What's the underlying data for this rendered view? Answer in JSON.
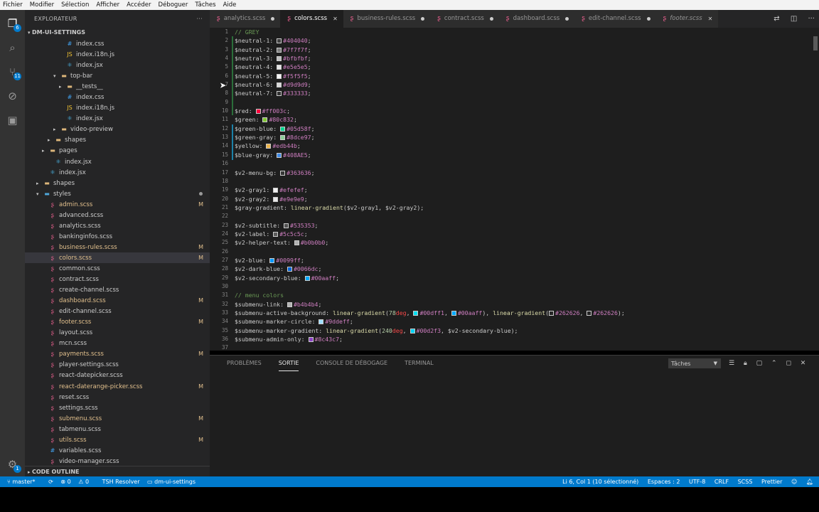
{
  "menu": [
    "Fichier",
    "Modifier",
    "Sélection",
    "Afficher",
    "Accéder",
    "Déboguer",
    "Tâches",
    "Aide"
  ],
  "activity": {
    "explorer_badge": "6",
    "scm_badge": "11",
    "settings_badge": "1"
  },
  "sidebar": {
    "title": "EXPLORATEUR",
    "dots": "···",
    "section": "DM-UI-SETTINGS",
    "outline": "CODE OUTLINE",
    "items": [
      {
        "label": "index.css",
        "indent": 5,
        "icon": "css",
        "arrow": ""
      },
      {
        "label": "index.i18n.js",
        "indent": 5,
        "icon": "js",
        "arrow": ""
      },
      {
        "label": "index.jsx",
        "indent": 5,
        "icon": "jsx",
        "arrow": ""
      },
      {
        "label": "top-bar",
        "indent": 4,
        "icon": "folder-open",
        "arrow": "▾"
      },
      {
        "label": "__tests__",
        "indent": 5,
        "icon": "folder-test",
        "arrow": "▸"
      },
      {
        "label": "index.css",
        "indent": 5,
        "icon": "css",
        "arrow": ""
      },
      {
        "label": "index.i18n.js",
        "indent": 5,
        "icon": "js",
        "arrow": ""
      },
      {
        "label": "index.jsx",
        "indent": 5,
        "icon": "jsx",
        "arrow": ""
      },
      {
        "label": "video-preview",
        "indent": 4,
        "icon": "folder",
        "arrow": "▸"
      },
      {
        "label": "shapes",
        "indent": 3,
        "icon": "folder",
        "arrow": "▸"
      },
      {
        "label": "pages",
        "indent": 2,
        "icon": "folder-pages",
        "arrow": "▸"
      },
      {
        "label": "index.jsx",
        "indent": 3,
        "icon": "jsx",
        "arrow": ""
      },
      {
        "label": "index.jsx",
        "indent": 2,
        "icon": "jsx",
        "arrow": ""
      },
      {
        "label": "shapes",
        "indent": 1,
        "icon": "folder",
        "arrow": "▸"
      },
      {
        "label": "styles",
        "indent": 1,
        "icon": "folder-styles",
        "arrow": "▾",
        "dot": true
      },
      {
        "label": "admin.scss",
        "indent": 2,
        "icon": "scss",
        "arrow": "",
        "mark": "M"
      },
      {
        "label": "advanced.scss",
        "indent": 2,
        "icon": "scss",
        "arrow": ""
      },
      {
        "label": "analytics.scss",
        "indent": 2,
        "icon": "scss",
        "arrow": ""
      },
      {
        "label": "bankinginfos.scss",
        "indent": 2,
        "icon": "scss",
        "arrow": ""
      },
      {
        "label": "business-rules.scss",
        "indent": 2,
        "icon": "scss",
        "arrow": "",
        "mark": "M"
      },
      {
        "label": "colors.scss",
        "indent": 2,
        "icon": "scss",
        "arrow": "",
        "mark": "M",
        "selected": true
      },
      {
        "label": "common.scss",
        "indent": 2,
        "icon": "scss",
        "arrow": ""
      },
      {
        "label": "contract.scss",
        "indent": 2,
        "icon": "scss",
        "arrow": ""
      },
      {
        "label": "create-channel.scss",
        "indent": 2,
        "icon": "scss",
        "arrow": ""
      },
      {
        "label": "dashboard.scss",
        "indent": 2,
        "icon": "scss",
        "arrow": "",
        "mark": "M"
      },
      {
        "label": "edit-channel.scss",
        "indent": 2,
        "icon": "scss",
        "arrow": ""
      },
      {
        "label": "footer.scss",
        "indent": 2,
        "icon": "scss",
        "arrow": "",
        "mark": "M"
      },
      {
        "label": "layout.scss",
        "indent": 2,
        "icon": "scss",
        "arrow": ""
      },
      {
        "label": "mcn.scss",
        "indent": 2,
        "icon": "scss",
        "arrow": ""
      },
      {
        "label": "payments.scss",
        "indent": 2,
        "icon": "scss",
        "arrow": "",
        "mark": "M"
      },
      {
        "label": "player-settings.scss",
        "indent": 2,
        "icon": "scss",
        "arrow": ""
      },
      {
        "label": "react-datepicker.scss",
        "indent": 2,
        "icon": "scss",
        "arrow": ""
      },
      {
        "label": "react-daterange-picker.scss",
        "indent": 2,
        "icon": "scss",
        "arrow": "",
        "mark": "M"
      },
      {
        "label": "reset.scss",
        "indent": 2,
        "icon": "scss",
        "arrow": ""
      },
      {
        "label": "settings.scss",
        "indent": 2,
        "icon": "scss",
        "arrow": ""
      },
      {
        "label": "submenu.scss",
        "indent": 2,
        "icon": "scss",
        "arrow": "",
        "mark": "M"
      },
      {
        "label": "tabmenu.scss",
        "indent": 2,
        "icon": "scss",
        "arrow": ""
      },
      {
        "label": "utils.scss",
        "indent": 2,
        "icon": "scss",
        "arrow": "",
        "mark": "M"
      },
      {
        "label": "variables.scss",
        "indent": 2,
        "icon": "css",
        "arrow": ""
      },
      {
        "label": "video-manager.scss",
        "indent": 2,
        "icon": "scss",
        "arrow": ""
      }
    ]
  },
  "tabs": [
    {
      "label": "analytics.scss",
      "state": "modified"
    },
    {
      "label": "colors.scss",
      "state": "active"
    },
    {
      "label": "business-rules.scss",
      "state": "modified"
    },
    {
      "label": "contract.scss",
      "state": "modified"
    },
    {
      "label": "dashboard.scss",
      "state": "modified"
    },
    {
      "label": "edit-channel.scss",
      "state": "modified"
    },
    {
      "label": "footer.scss",
      "state": "italic"
    }
  ],
  "editor": {
    "lines": [
      {
        "n": "1",
        "t": [
          [
            "com",
            "// GREY"
          ]
        ]
      },
      {
        "n": "2",
        "t": [
          [
            "var",
            "$neutral-1: "
          ],
          [
            "sw",
            "#404040"
          ],
          [
            "val",
            "#404040"
          ],
          [
            "var",
            ";"
          ]
        ]
      },
      {
        "n": "3",
        "t": [
          [
            "var",
            "$neutral-2: "
          ],
          [
            "sw",
            "#7f7f7f"
          ],
          [
            "val",
            "#7f7f7f"
          ],
          [
            "var",
            ";"
          ]
        ]
      },
      {
        "n": "4",
        "t": [
          [
            "var",
            "$neutral-3: "
          ],
          [
            "sw",
            "#bfbfbf"
          ],
          [
            "val",
            "#bfbfbf"
          ],
          [
            "var",
            ";"
          ]
        ]
      },
      {
        "n": "5",
        "t": [
          [
            "var",
            "$neutral-4: "
          ],
          [
            "sw",
            "#e5e5e5"
          ],
          [
            "val",
            "#e5e5e5"
          ],
          [
            "var",
            ";"
          ]
        ]
      },
      {
        "n": "6",
        "t": [
          [
            "var",
            "$neutral-5: "
          ],
          [
            "sw",
            "#f5f5f5"
          ],
          [
            "val",
            "#f5f5f5"
          ],
          [
            "var",
            ";"
          ]
        ]
      },
      {
        "n": "7",
        "t": [
          [
            "var",
            "$neutral-6: "
          ],
          [
            "sw",
            "#d9d9d9"
          ],
          [
            "val",
            "#d9d9d9"
          ],
          [
            "var",
            ";"
          ]
        ]
      },
      {
        "n": "8",
        "t": [
          [
            "var",
            "$neutral-7: "
          ],
          [
            "sw",
            "#333333"
          ],
          [
            "val",
            "#333333"
          ],
          [
            "var",
            ";"
          ]
        ]
      },
      {
        "n": "9",
        "t": []
      },
      {
        "n": "10",
        "t": [
          [
            "var",
            "$red: "
          ],
          [
            "sw",
            "#ff003c"
          ],
          [
            "val",
            "#ff003c"
          ],
          [
            "var",
            ";"
          ]
        ]
      },
      {
        "n": "11",
        "t": [
          [
            "var",
            "$green: "
          ],
          [
            "sw",
            "#80c832"
          ],
          [
            "val",
            "#80c832"
          ],
          [
            "var",
            ";"
          ]
        ]
      },
      {
        "n": "12",
        "t": [
          [
            "var",
            "$green-blue: "
          ],
          [
            "sw",
            "#05d58f"
          ],
          [
            "val",
            "#05d58f"
          ],
          [
            "var",
            ";"
          ]
        ]
      },
      {
        "n": "13",
        "t": [
          [
            "var",
            "$green-gray: "
          ],
          [
            "sw",
            "#8dce97"
          ],
          [
            "val",
            "#8dce97"
          ],
          [
            "var",
            ";"
          ]
        ]
      },
      {
        "n": "14",
        "t": [
          [
            "var",
            "$yellow: "
          ],
          [
            "sw",
            "#edb44b"
          ],
          [
            "val",
            "#edb44b"
          ],
          [
            "var",
            ";"
          ]
        ]
      },
      {
        "n": "15",
        "t": [
          [
            "var",
            "$blue-gray: "
          ],
          [
            "sw",
            "#408AE5"
          ],
          [
            "val",
            "#408AE5"
          ],
          [
            "var",
            ";"
          ]
        ]
      },
      {
        "n": "16",
        "t": []
      },
      {
        "n": "17",
        "t": [
          [
            "var",
            "$v2-menu-bg: "
          ],
          [
            "sw",
            "#363636"
          ],
          [
            "val",
            "#363636"
          ],
          [
            "var",
            ";"
          ]
        ]
      },
      {
        "n": "18",
        "t": []
      },
      {
        "n": "19",
        "t": [
          [
            "var",
            "$v2-gray1: "
          ],
          [
            "sw",
            "#efefef"
          ],
          [
            "val",
            "#efefef"
          ],
          [
            "var",
            ";"
          ]
        ]
      },
      {
        "n": "20",
        "t": [
          [
            "var",
            "$v2-gray2: "
          ],
          [
            "sw",
            "#e9e9e9"
          ],
          [
            "val",
            "#e9e9e9"
          ],
          [
            "var",
            ";"
          ]
        ]
      },
      {
        "n": "21",
        "t": [
          [
            "var",
            "$gray-gradient: "
          ],
          [
            "fn",
            "linear-gradient"
          ],
          [
            "var",
            "($v2-gray1, $v2-gray2);"
          ]
        ]
      },
      {
        "n": "22",
        "t": []
      },
      {
        "n": "23",
        "t": [
          [
            "var",
            "$v2-subtitle: "
          ],
          [
            "sw",
            "#535353"
          ],
          [
            "val",
            "#535353"
          ],
          [
            "var",
            ";"
          ]
        ]
      },
      {
        "n": "24",
        "t": [
          [
            "var",
            "$v2-label: "
          ],
          [
            "sw",
            "#5c5c5c"
          ],
          [
            "val",
            "#5c5c5c"
          ],
          [
            "var",
            ";"
          ]
        ]
      },
      {
        "n": "25",
        "t": [
          [
            "var",
            "$v2-helper-text: "
          ],
          [
            "sw",
            "#b0b0b0"
          ],
          [
            "val",
            "#b0b0b0"
          ],
          [
            "var",
            ";"
          ]
        ]
      },
      {
        "n": "26",
        "t": []
      },
      {
        "n": "27",
        "t": [
          [
            "var",
            "$v2-blue: "
          ],
          [
            "sw",
            "#0099ff"
          ],
          [
            "val",
            "#0099ff"
          ],
          [
            "var",
            ";"
          ]
        ]
      },
      {
        "n": "28",
        "t": [
          [
            "var",
            "$v2-dark-blue: "
          ],
          [
            "sw",
            "#0066dc"
          ],
          [
            "val",
            "#0066dc"
          ],
          [
            "var",
            ";"
          ]
        ]
      },
      {
        "n": "29",
        "t": [
          [
            "var",
            "$v2-secondary-blue: "
          ],
          [
            "sw",
            "#00aaff"
          ],
          [
            "val",
            "#00aaff"
          ],
          [
            "var",
            ";"
          ]
        ]
      },
      {
        "n": "30",
        "t": []
      },
      {
        "n": "31",
        "t": [
          [
            "com",
            "// menu colors"
          ]
        ]
      },
      {
        "n": "32",
        "t": [
          [
            "var",
            "$submenu-link: "
          ],
          [
            "sw",
            "#b4b4b4"
          ],
          [
            "val",
            "#b4b4b4"
          ],
          [
            "var",
            ";"
          ]
        ]
      },
      {
        "n": "33",
        "t": [
          [
            "var",
            "$submenu-active-background: "
          ],
          [
            "fn",
            "linear-gradient"
          ],
          [
            "var",
            "("
          ],
          [
            "num",
            "78"
          ],
          [
            "unit",
            "deg"
          ],
          [
            "var",
            ", "
          ],
          [
            "sw",
            "#00dff1"
          ],
          [
            "val",
            "#00dff1"
          ],
          [
            "var",
            ", "
          ],
          [
            "sw",
            "#00aaff"
          ],
          [
            "val",
            "#00aaff"
          ],
          [
            "var",
            "), "
          ],
          [
            "fn",
            "linear-gradient"
          ],
          [
            "var",
            "("
          ],
          [
            "sw",
            "#262626"
          ],
          [
            "val",
            "#262626"
          ],
          [
            "var",
            ", "
          ],
          [
            "sw",
            "#262626"
          ],
          [
            "val",
            "#262626"
          ],
          [
            "var",
            ");"
          ]
        ]
      },
      {
        "n": "34",
        "t": [
          [
            "var",
            "$submenu-marker-circle: "
          ],
          [
            "sw",
            "#9ddeff"
          ],
          [
            "val",
            "#9ddeff"
          ],
          [
            "var",
            ";"
          ]
        ]
      },
      {
        "n": "35",
        "t": [
          [
            "var",
            "$submenu-marker-gradient: "
          ],
          [
            "fn",
            "linear-gradient"
          ],
          [
            "var",
            "("
          ],
          [
            "num",
            "240"
          ],
          [
            "unit",
            "deg"
          ],
          [
            "var",
            ", "
          ],
          [
            "sw",
            "#00d2f3"
          ],
          [
            "val",
            "#00d2f3"
          ],
          [
            "var",
            ", $v2-secondary-blue);"
          ]
        ]
      },
      {
        "n": "36",
        "t": [
          [
            "var",
            "$submenu-admin-only: "
          ],
          [
            "sw",
            "#8c43c7"
          ],
          [
            "val",
            "#8c43c7"
          ],
          [
            "var",
            ";"
          ]
        ]
      },
      {
        "n": "37",
        "t": []
      }
    ]
  },
  "panel": {
    "tabs": [
      "PROBLÈMES",
      "SORTIE",
      "CONSOLE DE DÉBOGAGE",
      "TERMINAL"
    ],
    "active_tab": "SORTIE",
    "select_value": "Tâches"
  },
  "status": {
    "branch": "master*",
    "sync": "⟳",
    "errors": "⊗ 0",
    "warnings": "⚠ 0",
    "resolver": "TSH Resolver",
    "folder": "dm-ui-settings",
    "position": "Li 6, Col 1 (10 sélectionné)",
    "spaces": "Espaces : 2",
    "encoding": "UTF-8",
    "eol": "CRLF",
    "language": "SCSS",
    "formatter": "Prettier"
  },
  "colors": {
    "accent": "#007acc",
    "editor_bg": "#1e1e1e",
    "sidebar_bg": "#252526",
    "modified": "#e2c08d"
  }
}
